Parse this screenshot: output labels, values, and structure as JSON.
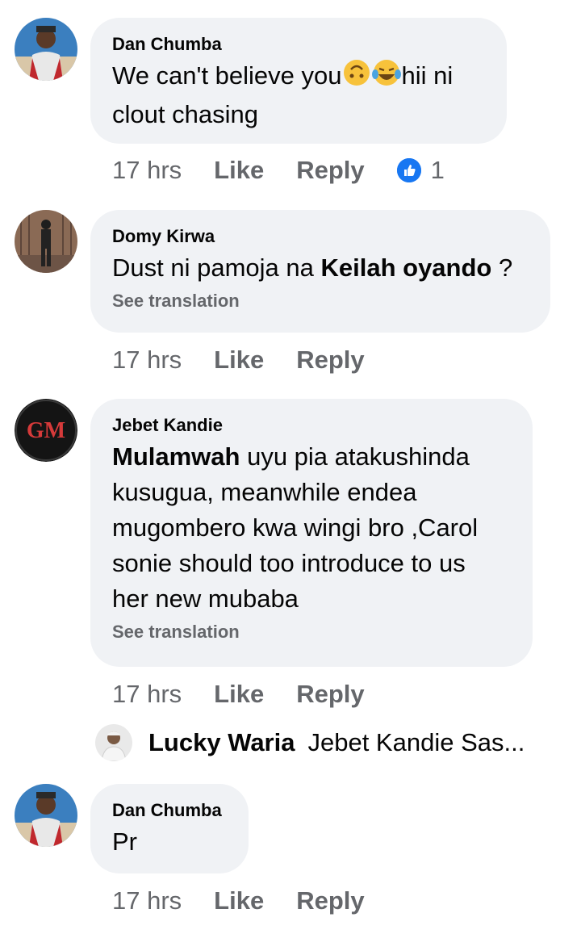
{
  "comments": [
    {
      "author": "Dan Chumba",
      "text_before": "We can't believe you",
      "emojis": [
        "upside-down-face",
        "tears-of-joy"
      ],
      "text_after": "hii ni",
      "text_line2": "clout chasing",
      "time": "17 hrs",
      "like_label": "Like",
      "reply_label": "Reply",
      "reaction_count": "1"
    },
    {
      "author": "Domy Kirwa",
      "text_before": "Dust ni pamoja na ",
      "mention": "Keilah oyando",
      "text_after": " ?",
      "see_translation": "See translation",
      "time": "17 hrs",
      "like_label": "Like",
      "reply_label": "Reply"
    },
    {
      "author": "Jebet Kandie",
      "mention": "Mulamwah",
      "text_line1_rest": " uyu pia atakushinda",
      "text_line2": "kusugua, meanwhile endea",
      "text_line3": "mugombero kwa wingi bro ,Carol",
      "text_line4": "sonie should too introduce to us",
      "text_line5": "her new mubaba",
      "see_translation": "See translation",
      "time": "17 hrs",
      "like_label": "Like",
      "reply_label": "Reply",
      "avatar_logo": "GM"
    },
    {
      "author": "Dan Chumba",
      "text": "Pr",
      "time": "17 hrs",
      "like_label": "Like",
      "reply_label": "Reply"
    }
  ],
  "reply_preview": {
    "author": "Lucky Waria",
    "text": "Jebet Kandie Sas..."
  },
  "colors": {
    "bubble": "#f0f2f5",
    "meta": "#65676b",
    "like_blue": "#1877f2"
  }
}
